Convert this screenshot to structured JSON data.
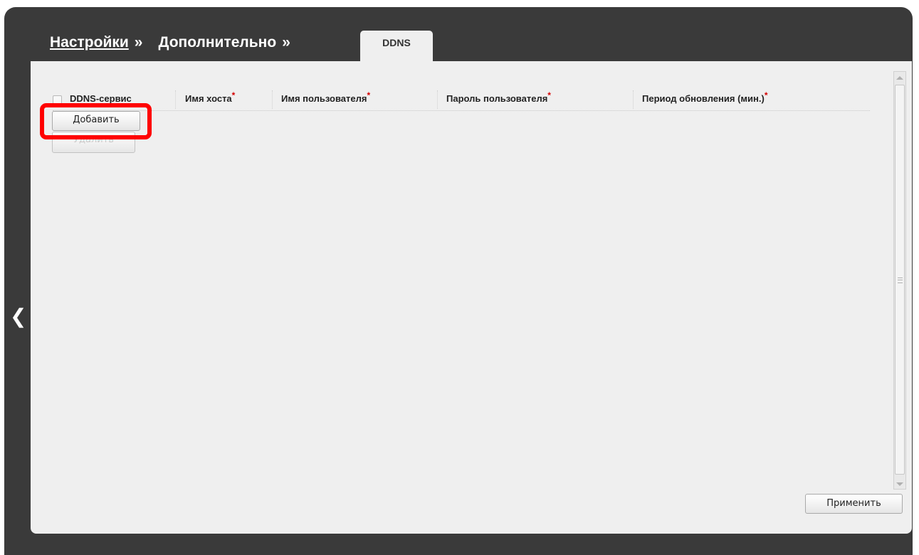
{
  "breadcrumb": {
    "settings": "Настройки",
    "sep1": "»",
    "advanced": "Дополнительно",
    "sep2": "»"
  },
  "tab": {
    "label": "DDNS"
  },
  "table": {
    "columns": [
      {
        "label": "DDNS-сервис",
        "required": false
      },
      {
        "label": "Имя хоста",
        "required": true
      },
      {
        "label": "Имя пользователя",
        "required": true
      },
      {
        "label": "Пароль пользователя",
        "required": true
      },
      {
        "label": "Период обновления (мин.)",
        "required": true
      }
    ],
    "required_mark": "*"
  },
  "buttons": {
    "add": "Добавить",
    "delete": "Удалить",
    "apply": "Применить"
  },
  "nav": {
    "back_icon": "chevron-left-icon",
    "back_glyph": "❮"
  },
  "colors": {
    "frame": "#3a3a3a",
    "panel": "#efefef",
    "highlight": "#ff0000",
    "required": "#d40000"
  }
}
